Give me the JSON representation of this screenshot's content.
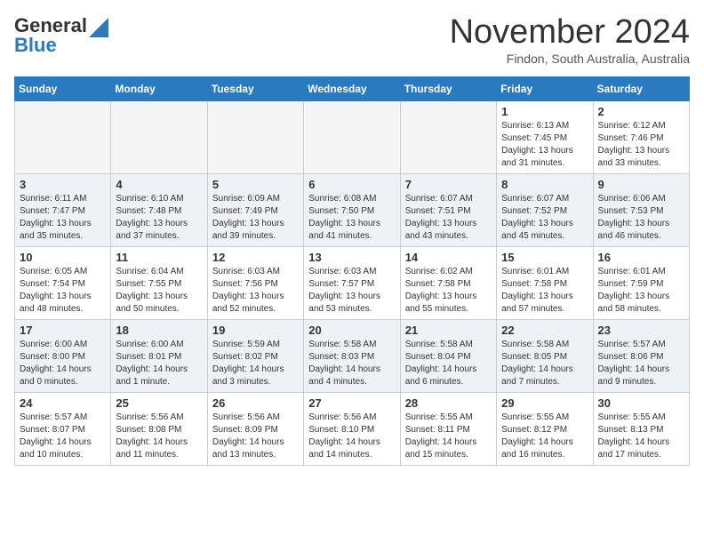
{
  "header": {
    "logo_general": "General",
    "logo_blue": "Blue",
    "month_title": "November 2024",
    "location": "Findon, South Australia, Australia"
  },
  "weekdays": [
    "Sunday",
    "Monday",
    "Tuesday",
    "Wednesday",
    "Thursday",
    "Friday",
    "Saturday"
  ],
  "weeks": [
    [
      {
        "day": "",
        "info": ""
      },
      {
        "day": "",
        "info": ""
      },
      {
        "day": "",
        "info": ""
      },
      {
        "day": "",
        "info": ""
      },
      {
        "day": "",
        "info": ""
      },
      {
        "day": "1",
        "info": "Sunrise: 6:13 AM\nSunset: 7:45 PM\nDaylight: 13 hours\nand 31 minutes."
      },
      {
        "day": "2",
        "info": "Sunrise: 6:12 AM\nSunset: 7:46 PM\nDaylight: 13 hours\nand 33 minutes."
      }
    ],
    [
      {
        "day": "3",
        "info": "Sunrise: 6:11 AM\nSunset: 7:47 PM\nDaylight: 13 hours\nand 35 minutes."
      },
      {
        "day": "4",
        "info": "Sunrise: 6:10 AM\nSunset: 7:48 PM\nDaylight: 13 hours\nand 37 minutes."
      },
      {
        "day": "5",
        "info": "Sunrise: 6:09 AM\nSunset: 7:49 PM\nDaylight: 13 hours\nand 39 minutes."
      },
      {
        "day": "6",
        "info": "Sunrise: 6:08 AM\nSunset: 7:50 PM\nDaylight: 13 hours\nand 41 minutes."
      },
      {
        "day": "7",
        "info": "Sunrise: 6:07 AM\nSunset: 7:51 PM\nDaylight: 13 hours\nand 43 minutes."
      },
      {
        "day": "8",
        "info": "Sunrise: 6:07 AM\nSunset: 7:52 PM\nDaylight: 13 hours\nand 45 minutes."
      },
      {
        "day": "9",
        "info": "Sunrise: 6:06 AM\nSunset: 7:53 PM\nDaylight: 13 hours\nand 46 minutes."
      }
    ],
    [
      {
        "day": "10",
        "info": "Sunrise: 6:05 AM\nSunset: 7:54 PM\nDaylight: 13 hours\nand 48 minutes."
      },
      {
        "day": "11",
        "info": "Sunrise: 6:04 AM\nSunset: 7:55 PM\nDaylight: 13 hours\nand 50 minutes."
      },
      {
        "day": "12",
        "info": "Sunrise: 6:03 AM\nSunset: 7:56 PM\nDaylight: 13 hours\nand 52 minutes."
      },
      {
        "day": "13",
        "info": "Sunrise: 6:03 AM\nSunset: 7:57 PM\nDaylight: 13 hours\nand 53 minutes."
      },
      {
        "day": "14",
        "info": "Sunrise: 6:02 AM\nSunset: 7:58 PM\nDaylight: 13 hours\nand 55 minutes."
      },
      {
        "day": "15",
        "info": "Sunrise: 6:01 AM\nSunset: 7:58 PM\nDaylight: 13 hours\nand 57 minutes."
      },
      {
        "day": "16",
        "info": "Sunrise: 6:01 AM\nSunset: 7:59 PM\nDaylight: 13 hours\nand 58 minutes."
      }
    ],
    [
      {
        "day": "17",
        "info": "Sunrise: 6:00 AM\nSunset: 8:00 PM\nDaylight: 14 hours\nand 0 minutes."
      },
      {
        "day": "18",
        "info": "Sunrise: 6:00 AM\nSunset: 8:01 PM\nDaylight: 14 hours\nand 1 minute."
      },
      {
        "day": "19",
        "info": "Sunrise: 5:59 AM\nSunset: 8:02 PM\nDaylight: 14 hours\nand 3 minutes."
      },
      {
        "day": "20",
        "info": "Sunrise: 5:58 AM\nSunset: 8:03 PM\nDaylight: 14 hours\nand 4 minutes."
      },
      {
        "day": "21",
        "info": "Sunrise: 5:58 AM\nSunset: 8:04 PM\nDaylight: 14 hours\nand 6 minutes."
      },
      {
        "day": "22",
        "info": "Sunrise: 5:58 AM\nSunset: 8:05 PM\nDaylight: 14 hours\nand 7 minutes."
      },
      {
        "day": "23",
        "info": "Sunrise: 5:57 AM\nSunset: 8:06 PM\nDaylight: 14 hours\nand 9 minutes."
      }
    ],
    [
      {
        "day": "24",
        "info": "Sunrise: 5:57 AM\nSunset: 8:07 PM\nDaylight: 14 hours\nand 10 minutes."
      },
      {
        "day": "25",
        "info": "Sunrise: 5:56 AM\nSunset: 8:08 PM\nDaylight: 14 hours\nand 11 minutes."
      },
      {
        "day": "26",
        "info": "Sunrise: 5:56 AM\nSunset: 8:09 PM\nDaylight: 14 hours\nand 13 minutes."
      },
      {
        "day": "27",
        "info": "Sunrise: 5:56 AM\nSunset: 8:10 PM\nDaylight: 14 hours\nand 14 minutes."
      },
      {
        "day": "28",
        "info": "Sunrise: 5:55 AM\nSunset: 8:11 PM\nDaylight: 14 hours\nand 15 minutes."
      },
      {
        "day": "29",
        "info": "Sunrise: 5:55 AM\nSunset: 8:12 PM\nDaylight: 14 hours\nand 16 minutes."
      },
      {
        "day": "30",
        "info": "Sunrise: 5:55 AM\nSunset: 8:13 PM\nDaylight: 14 hours\nand 17 minutes."
      }
    ]
  ]
}
